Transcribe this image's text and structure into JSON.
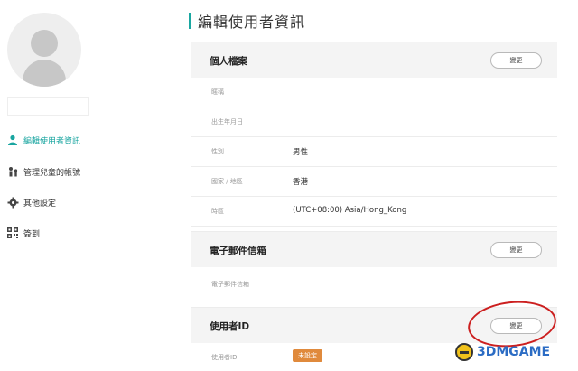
{
  "sidebar": {
    "items": [
      {
        "label": "編輯使用者資訊",
        "icon": "user-icon",
        "active": true
      },
      {
        "label": "管理兒童的帳號",
        "icon": "child-account-icon",
        "active": false
      },
      {
        "label": "其他設定",
        "icon": "gear-icon",
        "active": false
      },
      {
        "label": "簽到",
        "icon": "qr-code-icon",
        "active": false
      }
    ]
  },
  "header": {
    "title": "編輯使用者資訊"
  },
  "profile": {
    "title": "個人檔案",
    "edit_label": "變更",
    "rows": [
      {
        "label": "暱稱",
        "value": ""
      },
      {
        "label": "出生年月日",
        "value": ""
      },
      {
        "label": "性別",
        "value": "男性"
      },
      {
        "label": "國家 / 地區",
        "value": "香港"
      },
      {
        "label": "時區",
        "value": "(UTC+08:00) Asia/Hong_Kong"
      }
    ]
  },
  "email": {
    "title": "電子郵件信箱",
    "edit_label": "變更",
    "rows": [
      {
        "label": "電子郵件信箱",
        "value": ""
      }
    ]
  },
  "user_id": {
    "title": "使用者ID",
    "edit_label": "變更",
    "rows": [
      {
        "label": "使用者ID",
        "badge": "未設定"
      }
    ]
  },
  "watermark": {
    "text": "3DMGAME"
  },
  "colors": {
    "accent": "#1aa7a1",
    "badge": "#e08a3c",
    "highlight_circle": "#cc1f1f"
  }
}
